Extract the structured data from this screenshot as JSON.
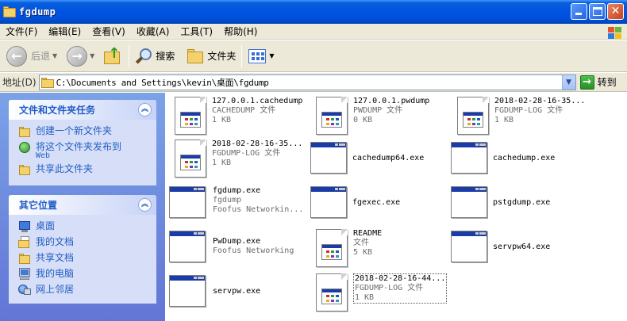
{
  "window": {
    "title": "fgdump"
  },
  "menu": [
    "文件(F)",
    "编辑(E)",
    "查看(V)",
    "收藏(A)",
    "工具(T)",
    "帮助(H)"
  ],
  "toolbar": {
    "back": "后退",
    "search": "搜索",
    "folders": "文件夹"
  },
  "address": {
    "label": "地址(D)",
    "path": "C:\\Documents and Settings\\kevin\\桌面\\fgdump",
    "go": "转到"
  },
  "tasks": {
    "title": "文件和文件夹任务",
    "items": [
      {
        "label": "创建一个新文件夹",
        "icon": "new-folder-icon"
      },
      {
        "label": "将这个文件夹发布到",
        "sub": "Web",
        "icon": "publish-web-icon"
      },
      {
        "label": "共享此文件夹",
        "icon": "share-folder-icon"
      }
    ]
  },
  "places": {
    "title": "其它位置",
    "items": [
      {
        "label": "桌面",
        "icon": "desktop-icon"
      },
      {
        "label": "我的文档",
        "icon": "my-documents-icon"
      },
      {
        "label": "共享文档",
        "icon": "shared-documents-icon"
      },
      {
        "label": "我的电脑",
        "icon": "my-computer-icon"
      },
      {
        "label": "网上邻居",
        "icon": "network-places-icon"
      }
    ]
  },
  "files": [
    {
      "name": "127.0.0.1.cachedump",
      "line2": "CACHEDUMP 文件",
      "line3": "1 KB",
      "type": "doc"
    },
    {
      "name": "127.0.0.1.pwdump",
      "line2": "PWDUMP 文件",
      "line3": "0 KB",
      "type": "doc"
    },
    {
      "name": "2018-02-28-16-35...",
      "line2": "FGDUMP-LOG 文件",
      "line3": "1 KB",
      "type": "doc"
    },
    {
      "name": "2018-02-28-16-35...",
      "line2": "FGDUMP-LOG 文件",
      "line3": "1 KB",
      "type": "doc"
    },
    {
      "name": "cachedump64.exe",
      "type": "exe"
    },
    {
      "name": "cachedump.exe",
      "type": "exe"
    },
    {
      "name": "fgdump.exe",
      "line2": "fgdump",
      "line3": "Foofus Networkin...",
      "type": "exe"
    },
    {
      "name": "fgexec.exe",
      "type": "exe"
    },
    {
      "name": "pstgdump.exe",
      "type": "exe"
    },
    {
      "name": "PwDump.exe",
      "line2": "Foofus Networking",
      "type": "exe"
    },
    {
      "name": "README",
      "line2": "文件",
      "line3": "5 KB",
      "type": "doc"
    },
    {
      "name": "servpw64.exe",
      "type": "exe"
    },
    {
      "name": "servpw.exe",
      "type": "exe"
    },
    {
      "name": "2018-02-28-16-44...",
      "line2": "FGDUMP-LOG 文件",
      "line3": "1 KB",
      "type": "doc",
      "selected": true
    }
  ]
}
